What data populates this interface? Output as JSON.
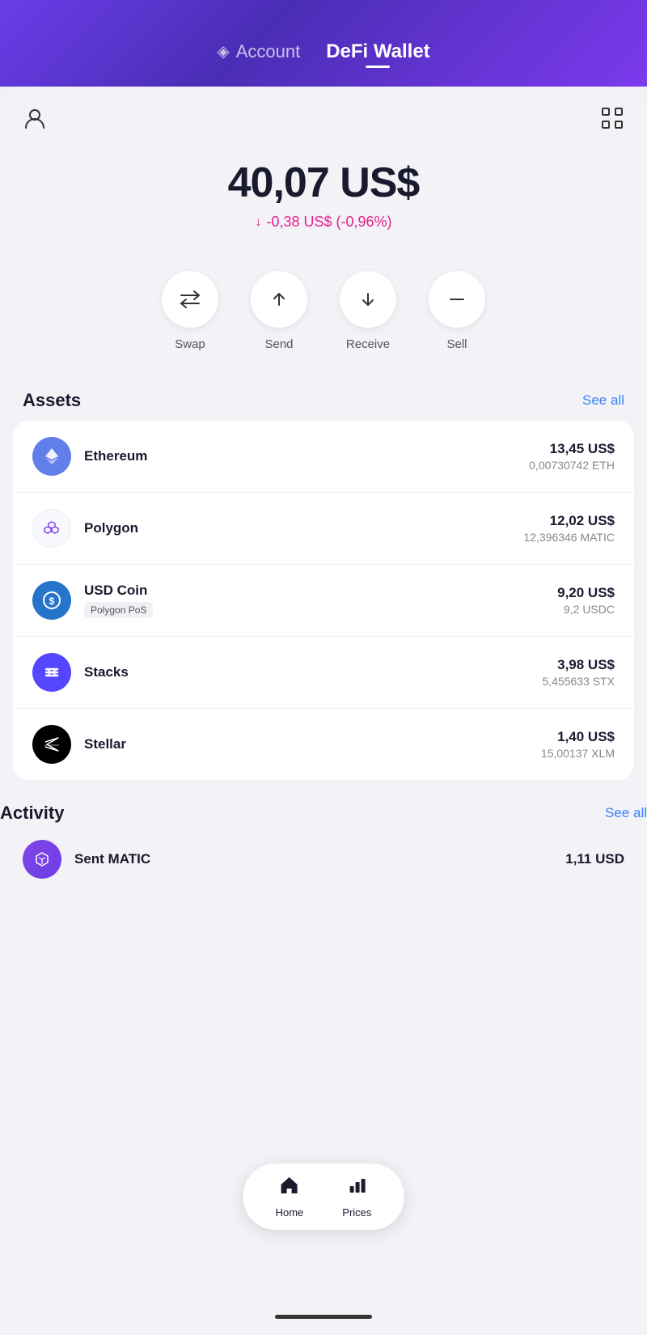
{
  "header": {
    "account_label": "Account",
    "defi_label": "DeFi Wallet"
  },
  "balance": {
    "amount": "40,07 US$",
    "change": "-0,38 US$  (-0,96%)"
  },
  "actions": [
    {
      "id": "swap",
      "label": "Swap"
    },
    {
      "id": "send",
      "label": "Send"
    },
    {
      "id": "receive",
      "label": "Receive"
    },
    {
      "id": "sell",
      "label": "Sell"
    }
  ],
  "assets_section": {
    "title": "Assets",
    "see_all": "See all"
  },
  "assets": [
    {
      "name": "Ethereum",
      "badge": "",
      "usd": "13,45 US$",
      "crypto": "0,00730742 ETH",
      "icon_color": "#627eea",
      "icon_type": "eth"
    },
    {
      "name": "Polygon",
      "badge": "",
      "usd": "12,02 US$",
      "crypto": "12,396346 MATIC",
      "icon_color": "#f8f8ff",
      "icon_type": "polygon"
    },
    {
      "name": "USD Coin",
      "badge": "Polygon PoS",
      "usd": "9,20 US$",
      "crypto": "9,2 USDC",
      "icon_color": "#2775ca",
      "icon_type": "usdc"
    },
    {
      "name": "Stacks",
      "badge": "",
      "usd": "3,98 US$",
      "crypto": "5,455633 STX",
      "icon_color": "#5546ff",
      "icon_type": "stacks"
    },
    {
      "name": "Stellar",
      "badge": "",
      "usd": "1,40 US$",
      "crypto": "15,00137 XLM",
      "icon_color": "#000000",
      "icon_type": "stellar"
    }
  ],
  "activity_section": {
    "title": "Activity",
    "see_all": "See all"
  },
  "activity": [
    {
      "name": "Sent MATIC",
      "value": "1,11 USD",
      "icon_type": "matic"
    }
  ],
  "nav": {
    "home_label": "Home",
    "prices_label": "Prices"
  }
}
